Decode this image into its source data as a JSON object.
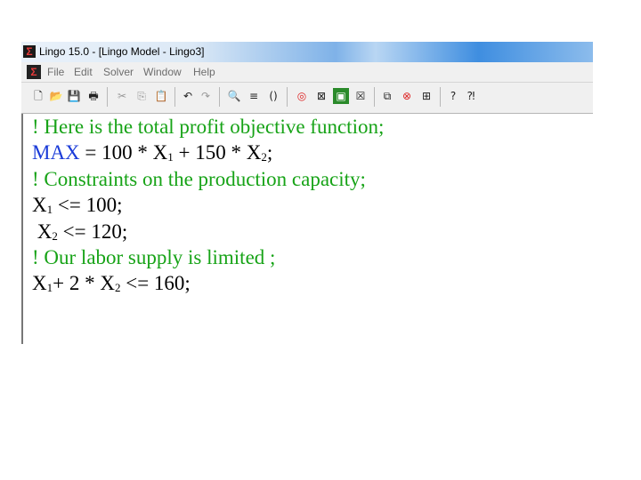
{
  "window": {
    "title": "Lingo 15.0 - [Lingo Model - Lingo3]"
  },
  "menu": [
    "File",
    "Edit",
    "Solver",
    "Window",
    "Help"
  ],
  "toolbar_icons": [
    "new-file-icon",
    "open-file-icon",
    "save-icon",
    "print-icon",
    "cut-icon",
    "copy-icon",
    "paste-icon",
    "undo-icon",
    "redo-icon",
    "find-icon",
    "goto-line-icon",
    "match-parenthesis-icon",
    "solve-icon",
    "solution-icon",
    "matrix-picture-icon",
    "options-icon",
    "send-to-back-icon",
    "close-all-icon",
    "tile-icon",
    "help-icon",
    "context-help-icon"
  ],
  "model": {
    "line1": "! Here is the total profit objective function;",
    "line2_kw": "MAX",
    "line2_a": " = 100 * X",
    "line2_s1": "1",
    "line2_b": " + 150 * X",
    "line2_s2": "2",
    "line2_c": ";",
    "line3": "! Constraints on the production capacity;",
    "line4_a": "X",
    "line4_s": "1",
    "line4_b": " <= 100;",
    "line5_a": " X",
    "line5_s": "2",
    "line5_b": " <= 120;",
    "line6": "! Our labor supply is limited ;",
    "line7_a": "X",
    "line7_s1": "1",
    "line7_b": "+ 2 * X",
    "line7_s2": "2",
    "line7_c": " <= 160;"
  },
  "colors": {
    "comment": "#17a317",
    "keyword": "#1a3bd8"
  }
}
